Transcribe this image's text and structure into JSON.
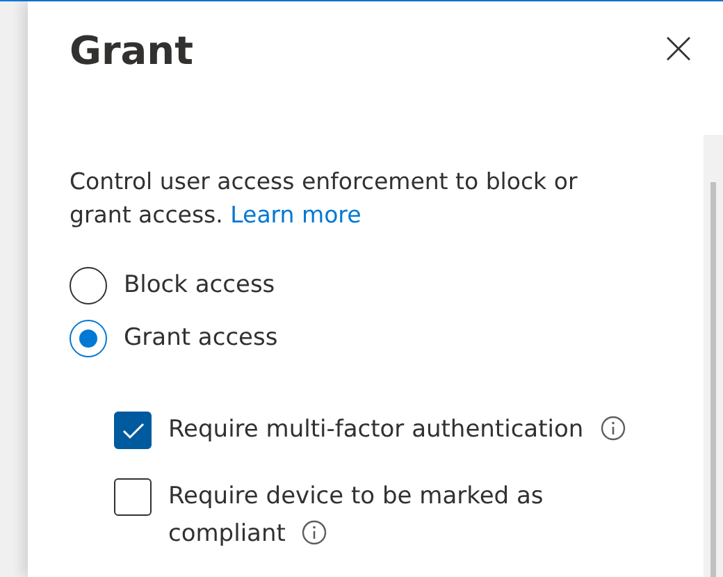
{
  "panel": {
    "title": "Grant",
    "description": "Control user access enforcement to block or grant access.",
    "link": "Learn more"
  },
  "access_options": [
    {
      "label": "Block access",
      "selected": false
    },
    {
      "label": "Grant access",
      "selected": true
    }
  ],
  "requirements": [
    {
      "label": "Require multi-factor authentication",
      "checked": true,
      "info": true
    },
    {
      "label": "Require device to be marked as compliant",
      "checked": false,
      "info": true
    }
  ]
}
